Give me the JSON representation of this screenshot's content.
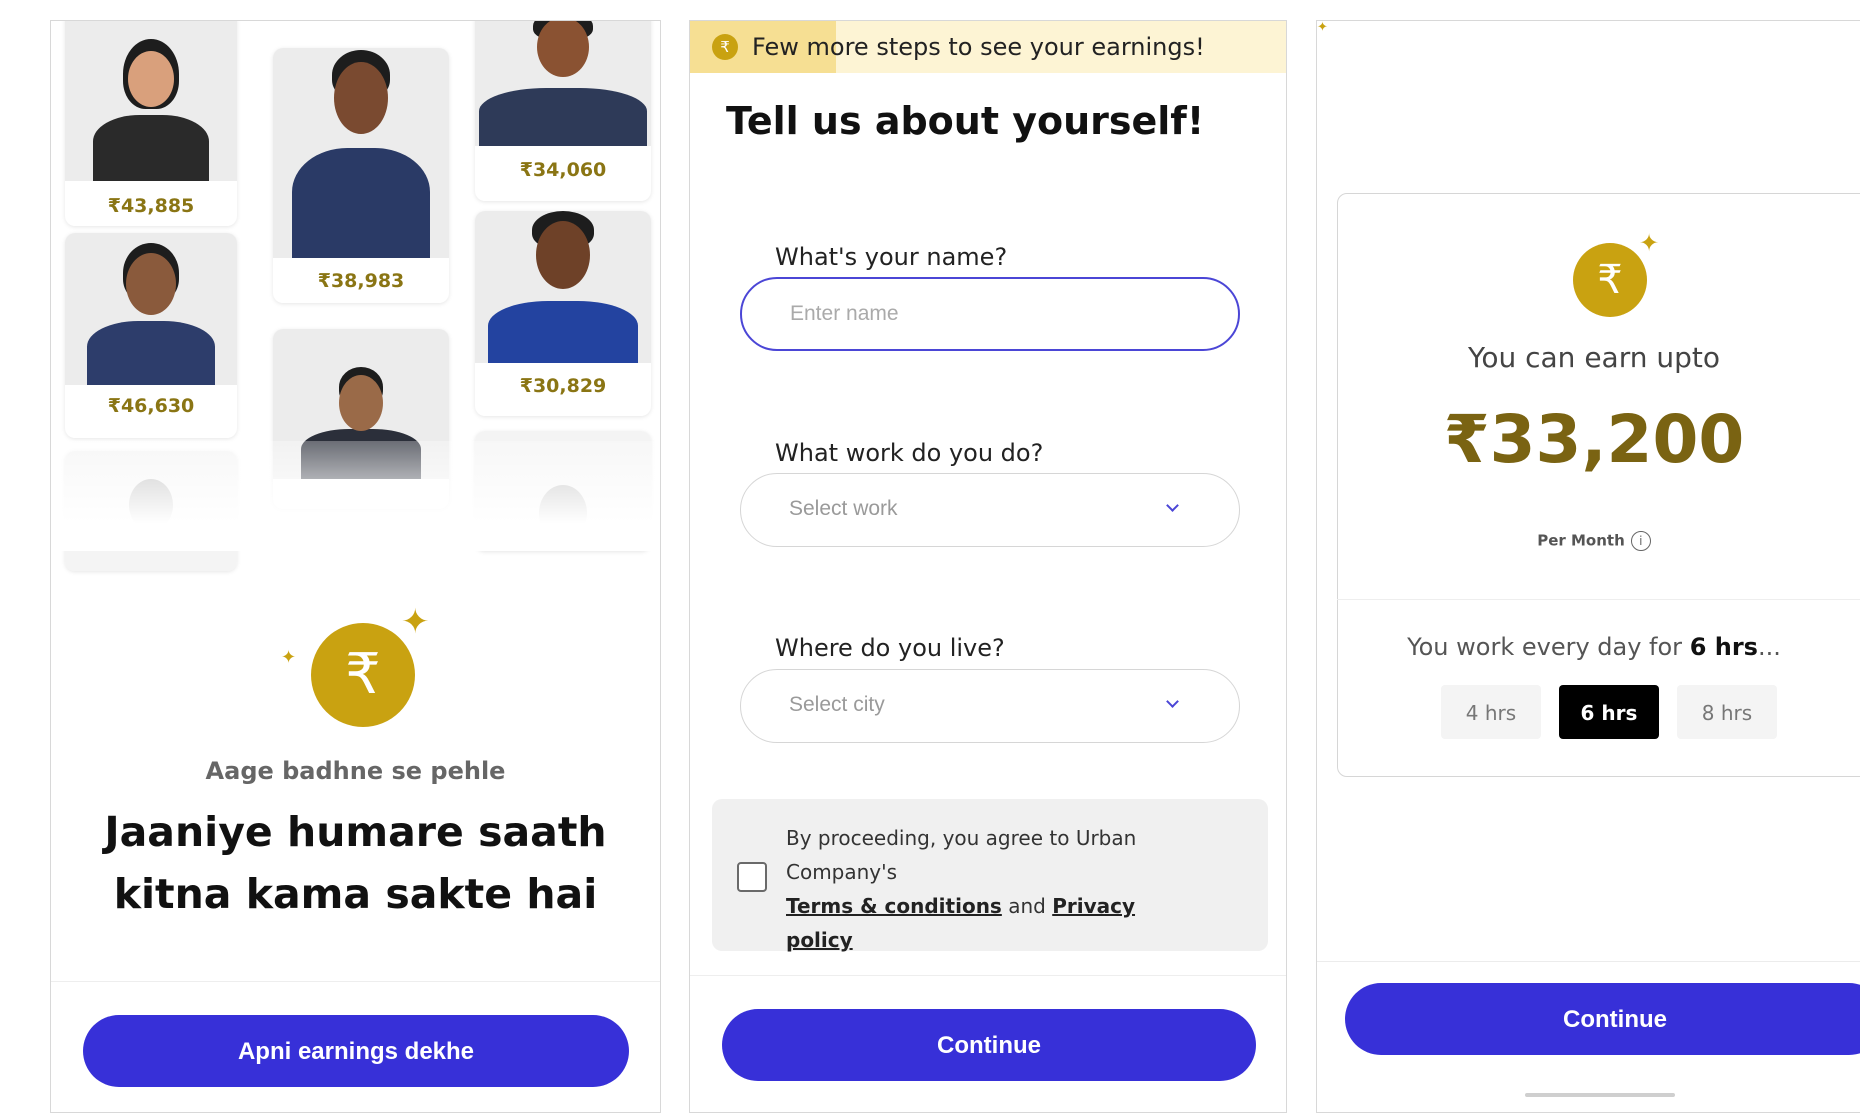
{
  "screen1": {
    "earnings": [
      "₹43,885",
      "₹38,983",
      "₹34,060",
      "₹46,630",
      "₹30,829"
    ],
    "subtitle": "Aage badhne se pehle",
    "headline_line1": "Jaaniye humare saath",
    "headline_line2": "kitna kama sakte hai",
    "button": "Apni earnings dekhe"
  },
  "screen2": {
    "banner": "Few more steps to see your earnings!",
    "title": "Tell us about yourself!",
    "name_label": "What's your name?",
    "name_placeholder": "Enter name",
    "work_label": "What work do you do?",
    "work_select": "Select work",
    "city_label": "Where do you live?",
    "city_select": "Select city",
    "consent_prefix": "By proceeding, you agree to Urban Company's",
    "terms_link": "Terms & conditions",
    "consent_and": "and",
    "privacy_link": "Privacy policy",
    "button": "Continue"
  },
  "screen3": {
    "intro": "You can earn upto",
    "amount": "₹33,200",
    "per_month": "Per Month",
    "work_prefix": "You work every day for",
    "work_hours": "6 hrs",
    "work_suffix": "...",
    "hours_options": [
      "4 hrs",
      "6 hrs",
      "8 hrs"
    ],
    "selected_hours": "6 hrs",
    "button": "Continue"
  },
  "colors": {
    "primary": "#3730d8",
    "gold": "#c9a211",
    "earning_text": "#8a7514"
  },
  "icons": {
    "rupee": "₹",
    "sparkle": "✦",
    "chevron": "chevron-down-icon",
    "info": "info-icon"
  }
}
